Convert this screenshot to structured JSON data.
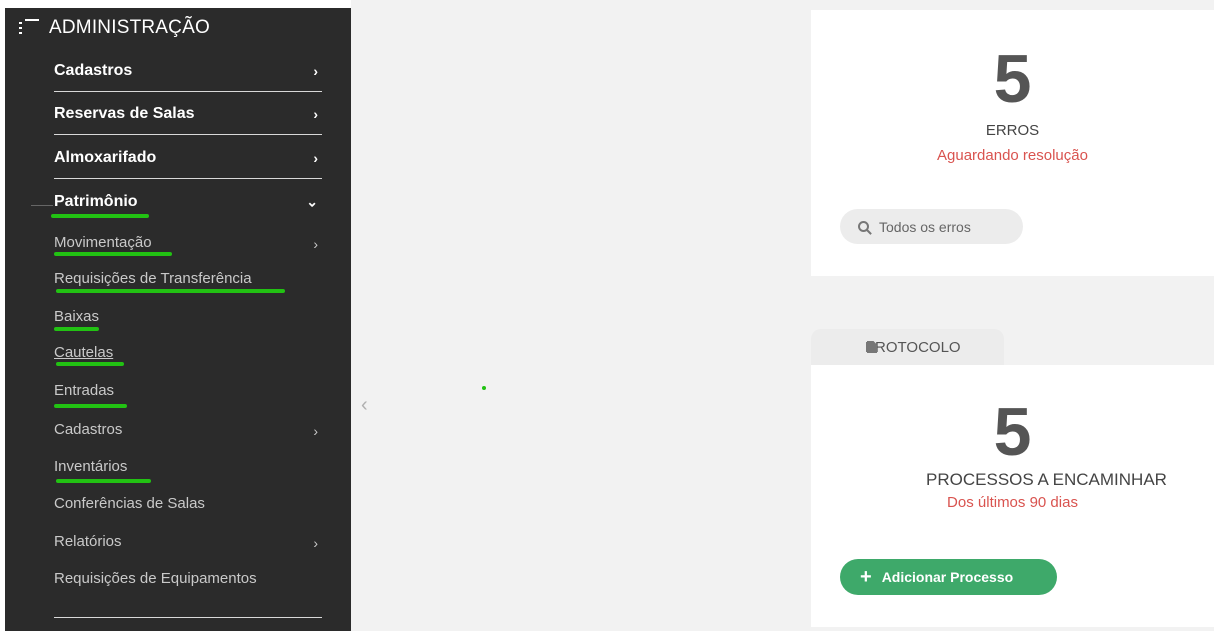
{
  "sidebar": {
    "header": "ADMINISTRAÇÃO",
    "items": [
      {
        "label": "Cadastros",
        "chevron": "›"
      },
      {
        "label": "Reservas de Salas",
        "chevron": "›"
      },
      {
        "label": "Almoxarifado",
        "chevron": "›"
      },
      {
        "label": "Patrimônio",
        "chevron": "⌄"
      }
    ],
    "subitems": [
      {
        "label": "Movimentação",
        "chevron": "›"
      },
      {
        "label": "Requisições de Transferência"
      },
      {
        "label": "Baixas"
      },
      {
        "label": "Cautelas"
      },
      {
        "label": "Entradas"
      },
      {
        "label": "Cadastros",
        "chevron": "›"
      },
      {
        "label": "Inventários"
      },
      {
        "label": "Conferências de Salas"
      },
      {
        "label": "Relatórios",
        "chevron": "›"
      },
      {
        "label": "Requisições de Equipamentos"
      }
    ]
  },
  "collapse_arrow": "‹",
  "errors_card": {
    "count": "5",
    "title": "ERROS",
    "subtitle": "Aguardando resolução",
    "button": "Todos os erros"
  },
  "protocol_card": {
    "tab": "PROTOCOLO",
    "count": "5",
    "title": "PROCESSOS A ENCAMINHAR",
    "subtitle": "Dos últimos 90 dias",
    "button": "Adicionar Processo",
    "button_icon": "+"
  },
  "colors": {
    "highlight": "#22c213",
    "sidebar_bg": "#2b2b2b",
    "alert": "#d9534f",
    "primary_button": "#3ea96a"
  }
}
